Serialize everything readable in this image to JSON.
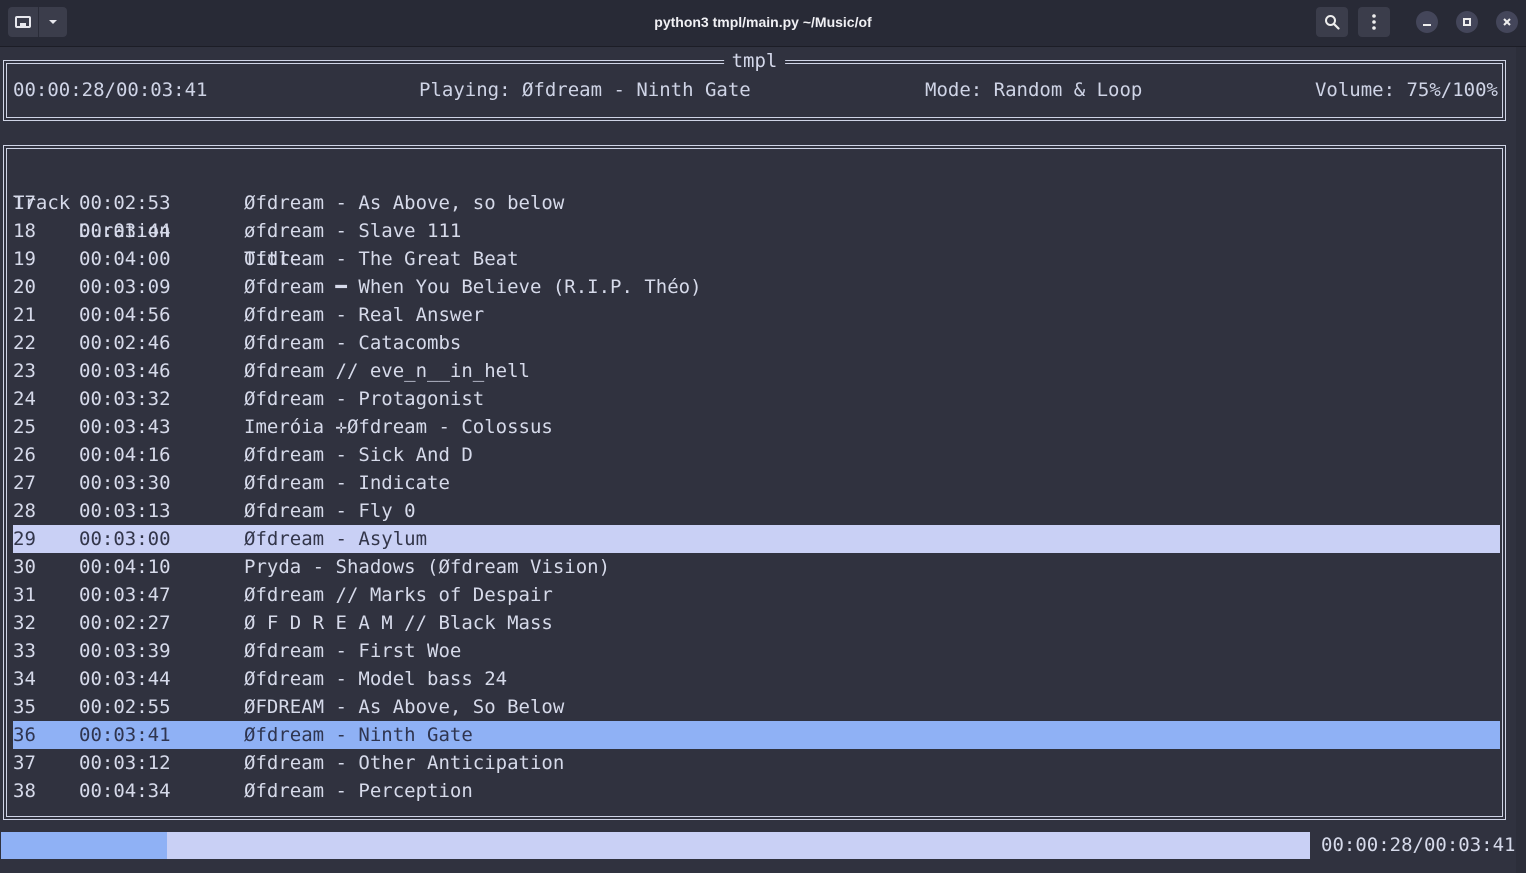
{
  "window": {
    "title": "python3 tmpl/main.py ~/Music/of"
  },
  "header": {
    "app_name": "tmpl",
    "elapsed_total": "00:00:28/00:03:41",
    "playing": "Playing: Øfdream - Ninth Gate",
    "mode": "Mode: Random & Loop",
    "volume": "Volume: 75%/100%"
  },
  "table": {
    "columns": [
      "Track",
      "Duration",
      "Title"
    ],
    "rows": [
      {
        "track": "17",
        "duration": "00:02:53",
        "title": "Øfdream - As Above, so below"
      },
      {
        "track": "18",
        "duration": "00:03:44",
        "title": "øfdream - Slave 111"
      },
      {
        "track": "19",
        "duration": "00:04:00",
        "title": "Ofdream - The Great Beat"
      },
      {
        "track": "20",
        "duration": "00:03:09",
        "title": "Øfdream ━ When You Believe (R.I.P. Théo)"
      },
      {
        "track": "21",
        "duration": "00:04:56",
        "title": "Øfdream - Real Answer"
      },
      {
        "track": "22",
        "duration": "00:02:46",
        "title": "Øfdream - Catacombs"
      },
      {
        "track": "23",
        "duration": "00:03:46",
        "title": "Øfdream // eve_n__in_hell"
      },
      {
        "track": "24",
        "duration": "00:03:32",
        "title": "Øfdream - Protagonist"
      },
      {
        "track": "25",
        "duration": "00:03:43",
        "title": "Imeróia ✛Øfdream - Colossus"
      },
      {
        "track": "26",
        "duration": "00:04:16",
        "title": "Øfdream - Sick And D"
      },
      {
        "track": "27",
        "duration": "00:03:30",
        "title": "Øfdream - Indicate"
      },
      {
        "track": "28",
        "duration": "00:03:13",
        "title": "Øfdream - Fly 0"
      },
      {
        "track": "29",
        "duration": "00:03:00",
        "title": "Øfdream - Asylum"
      },
      {
        "track": "30",
        "duration": "00:04:10",
        "title": "Pryda - Shadows (Øfdream Vision)"
      },
      {
        "track": "31",
        "duration": "00:03:47",
        "title": "Øfdream // Marks of Despair"
      },
      {
        "track": "32",
        "duration": "00:02:27",
        "title": "Ø F D R E A M // Black Mass"
      },
      {
        "track": "33",
        "duration": "00:03:39",
        "title": "Øfdream - First Woe"
      },
      {
        "track": "34",
        "duration": "00:03:44",
        "title": "Øfdream - Model bass 24"
      },
      {
        "track": "35",
        "duration": "00:02:55",
        "title": "ØFDREAM - As Above, So Below"
      },
      {
        "track": "36",
        "duration": "00:03:41",
        "title": "Øfdream - Ninth Gate"
      },
      {
        "track": "37",
        "duration": "00:03:12",
        "title": "Øfdream - Other Anticipation"
      },
      {
        "track": "38",
        "duration": "00:04:34",
        "title": "Øfdream - Perception"
      }
    ],
    "cursor_row_track": "29",
    "playing_row_track": "36"
  },
  "footer": {
    "progress_fraction": 0.127,
    "time": "00:00:28/00:03:41"
  },
  "icons": {
    "new_tab": "new-tab-icon",
    "dropdown": "chevron-down-icon",
    "search": "search-icon",
    "menu": "kebab-menu-icon",
    "minimize": "minimize-icon",
    "maximize": "maximize-icon",
    "close": "close-icon"
  },
  "colors": {
    "background": "#30323f",
    "cursor_row": "#c9d0f5",
    "playing_row": "#8fb1f5"
  }
}
